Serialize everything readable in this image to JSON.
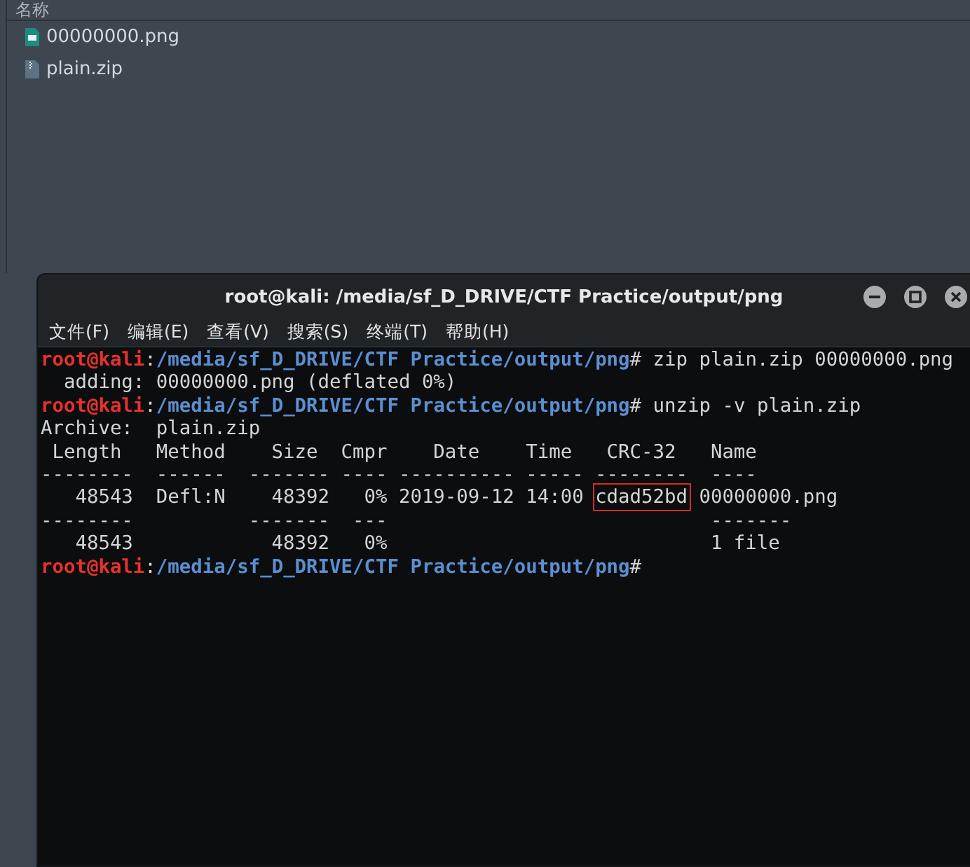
{
  "file_list": {
    "column_header": "名称",
    "files": [
      {
        "name": "00000000.png",
        "kind": "image"
      },
      {
        "name": "plain.zip",
        "kind": "archive"
      }
    ]
  },
  "terminal": {
    "title": "root@kali: /media/sf_D_DRIVE/CTF Practice/output/png",
    "menu": [
      "文件(F)",
      "编辑(E)",
      "查看(V)",
      "搜索(S)",
      "终端(T)",
      "帮助(H)"
    ],
    "lines": [
      {
        "kind": "prompt",
        "user": "root@kali",
        "separator": ":",
        "path": "/media/sf_D_DRIVE/CTF Practice/output/png",
        "prompt_char": "#",
        "command": "zip plain.zip 00000000.png"
      },
      {
        "kind": "output",
        "text": "  adding: 00000000.png (deflated 0%)"
      },
      {
        "kind": "prompt",
        "user": "root@kali",
        "separator": ":",
        "path": "/media/sf_D_DRIVE/CTF Practice/output/png",
        "prompt_char": "#",
        "command": "unzip -v plain.zip"
      },
      {
        "kind": "output",
        "text": "Archive:  plain.zip"
      },
      {
        "kind": "output",
        "text": " Length   Method    Size  Cmpr    Date    Time   CRC-32   Name"
      },
      {
        "kind": "output",
        "text": "--------  ------  ------- ---- ---------- ----- --------  ----"
      },
      {
        "kind": "output",
        "text": "   48543  Defl:N    48392   0% 2019-09-12 14:00 ",
        "highlight": "cdad52bd",
        "after": "00000000.png"
      },
      {
        "kind": "output",
        "text": "--------          -------  ---                            -------"
      },
      {
        "kind": "output",
        "text": "   48543            48392   0%                            1 file"
      },
      {
        "kind": "prompt",
        "user": "root@kali",
        "separator": ":",
        "path": "/media/sf_D_DRIVE/CTF Practice/output/png",
        "prompt_char": "#"
      }
    ]
  }
}
